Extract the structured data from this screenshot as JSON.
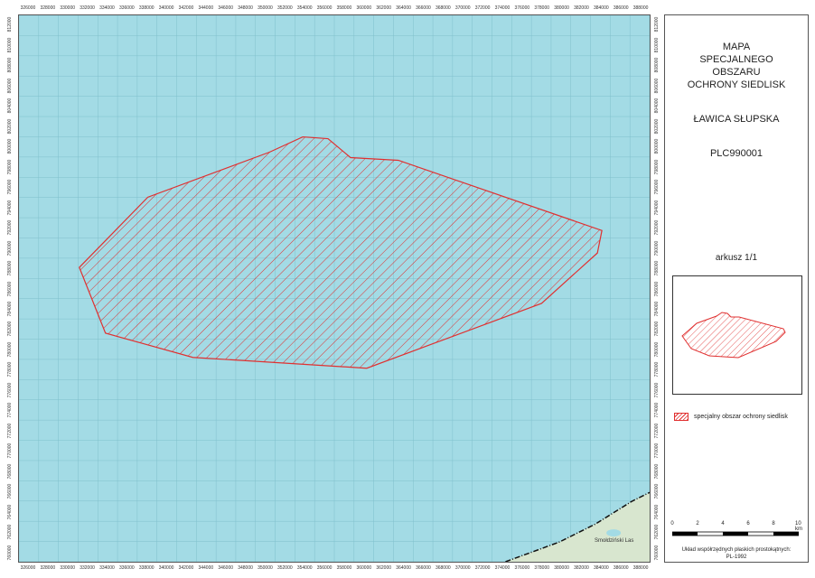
{
  "map": {
    "x_ticks": [
      "326000",
      "328000",
      "330000",
      "332000",
      "334000",
      "336000",
      "338000",
      "340000",
      "342000",
      "344000",
      "346000",
      "348000",
      "350000",
      "352000",
      "354000",
      "356000",
      "358000",
      "360000",
      "362000",
      "364000",
      "366000",
      "368000",
      "370000",
      "372000",
      "374000",
      "376000",
      "378000",
      "380000",
      "382000",
      "384000",
      "386000",
      "388000"
    ],
    "y_ticks": [
      "812000",
      "810000",
      "808000",
      "806000",
      "804000",
      "802000",
      "800000",
      "798000",
      "796000",
      "794000",
      "792000",
      "790000",
      "788000",
      "786000",
      "784000",
      "782000",
      "780000",
      "778000",
      "776000",
      "774000",
      "772000",
      "770000",
      "768000",
      "766000",
      "764000",
      "762000",
      "760000"
    ],
    "place_label": "Smołdziński Las",
    "colors": {
      "sea": "#a3dbe5",
      "grid": "#7fc0cc",
      "boundary": "#e03030",
      "land": "#d8e6cf"
    }
  },
  "panel": {
    "title_lines": [
      "MAPA",
      "SPECJALNEGO",
      "OBSZARU",
      "OCHRONY SIEDLISK"
    ],
    "area_name": "ŁAWICA SŁUPSKA",
    "area_code": "PLC990001",
    "sheet": "arkusz 1/1",
    "legend_label": "specjalny obszar ochrony siedlisk",
    "scale_labels": [
      "0",
      "2",
      "4",
      "6",
      "8",
      "10 km"
    ],
    "coords_line1": "Układ współrzędnych płaskich prostokątnych:",
    "coords_line2": "PL-1992"
  }
}
